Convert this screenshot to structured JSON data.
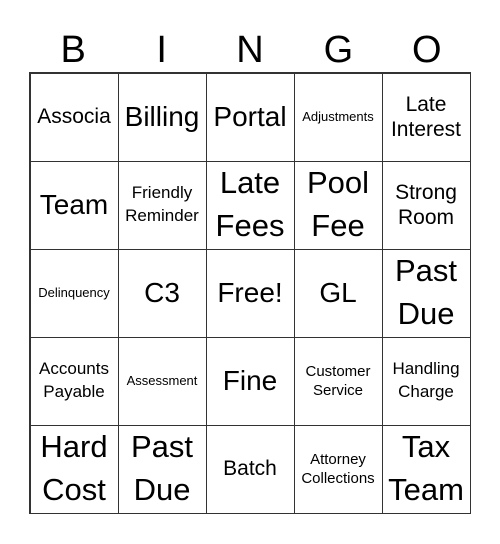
{
  "header": [
    "B",
    "I",
    "N",
    "G",
    "O"
  ],
  "cells": [
    [
      "Associa",
      "Billing",
      "Portal",
      "Adjustments",
      "Late Interest"
    ],
    [
      "Team",
      "Friendly Reminder",
      "Late Fees",
      "Pool Fee",
      "Strong Room"
    ],
    [
      "Delinquency",
      "C3",
      "Free!",
      "GL",
      "Past Due"
    ],
    [
      "Accounts Payable",
      "Assessment",
      "Fine",
      "Customer Service",
      "Handling Charge"
    ],
    [
      "Hard Cost",
      "Past Due",
      "Batch",
      "Attorney Collections",
      "Tax Team"
    ]
  ]
}
